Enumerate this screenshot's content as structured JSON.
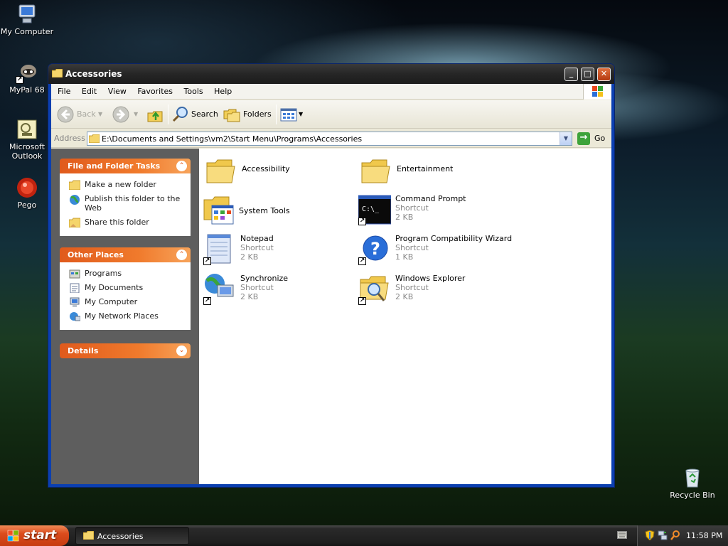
{
  "desktop": {
    "icons": [
      {
        "label": "My Computer"
      },
      {
        "label": "MyPal 68"
      },
      {
        "label": "Microsoft Outlook"
      },
      {
        "label": "Pego"
      },
      {
        "label": "Recycle Bin"
      }
    ]
  },
  "window": {
    "title": "Accessories",
    "menu": [
      "File",
      "Edit",
      "View",
      "Favorites",
      "Tools",
      "Help"
    ],
    "toolbar": {
      "back": "Back",
      "search": "Search",
      "folders": "Folders"
    },
    "address": {
      "label": "Address",
      "path": "E:\\Documents and Settings\\vm2\\Start Menu\\Programs\\Accessories",
      "go": "Go"
    },
    "tasks": {
      "title": "File and Folder Tasks",
      "items": [
        "Make a new folder",
        "Publish this folder to the Web",
        "Share this folder"
      ]
    },
    "other_places": {
      "title": "Other Places",
      "items": [
        "Programs",
        "My Documents",
        "My Computer",
        "My Network Places"
      ]
    },
    "details": {
      "title": "Details"
    },
    "files": [
      {
        "name": "Accessibility",
        "type": "",
        "size": ""
      },
      {
        "name": "Entertainment",
        "type": "",
        "size": ""
      },
      {
        "name": "System Tools",
        "type": "",
        "size": ""
      },
      {
        "name": "Command Prompt",
        "type": "Shortcut",
        "size": "2 KB"
      },
      {
        "name": "Notepad",
        "type": "Shortcut",
        "size": "2 KB"
      },
      {
        "name": "Program Compatibility Wizard",
        "type": "Shortcut",
        "size": "1 KB"
      },
      {
        "name": "Synchronize",
        "type": "Shortcut",
        "size": "2 KB"
      },
      {
        "name": "Windows Explorer",
        "type": "Shortcut",
        "size": "2 KB"
      }
    ]
  },
  "taskbar": {
    "start": "start",
    "task_button": "Accessories",
    "clock": "11:58 PM"
  },
  "colors": {
    "panel_header": "#e05a1c",
    "titlebar": "#262626",
    "start_button": "#dc4c1d"
  }
}
